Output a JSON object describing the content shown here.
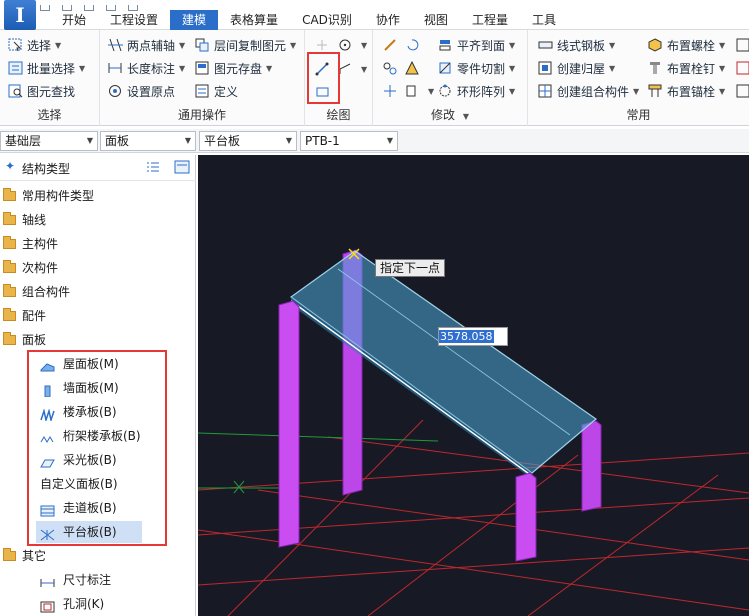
{
  "app": {
    "logo_letter": "I"
  },
  "tabs": [
    "开始",
    "工程设置",
    "建模",
    "表格算量",
    "CAD识别",
    "协作",
    "视图",
    "工程量",
    "工具"
  ],
  "ribbon": {
    "select_group": {
      "title": "选择",
      "items": [
        "选择",
        "批量选择",
        "图元查找"
      ]
    },
    "common_ops_group": {
      "title": "通用操作",
      "items": [
        "两点辅轴",
        "长度标注",
        "设置原点",
        "层间复制图元",
        "图元存盘",
        "定义"
      ]
    },
    "draw_group": {
      "title": "绘图"
    },
    "modify_group": {
      "title": "修改",
      "items": [
        "平齐到面",
        "零件切割",
        "环形阵列"
      ]
    },
    "common_group": {
      "title": "常用",
      "items": [
        "线式钢板",
        "创建归屋",
        "创建组合构件",
        "布置螺栓",
        "布置栓钉",
        "布置锚栓"
      ]
    }
  },
  "selectors": {
    "floor": "基础层",
    "category": "面板",
    "type": "平台板",
    "member": "PTB-1"
  },
  "tree": {
    "header": "结构类型",
    "folders": [
      "常用构件类型",
      "轴线",
      "主构件",
      "次构件",
      "组合构件",
      "配件",
      "面板",
      "其它"
    ],
    "panel_items": [
      "屋面板(M)",
      "墙面板(M)",
      "楼承板(B)",
      "桁架楼承板(B)",
      "采光板(B)",
      "自定义面板(B)",
      "走道板(B)",
      "平台板(B)"
    ],
    "other_items": [
      "尺寸标注",
      "孔洞(K)"
    ]
  },
  "viewport": {
    "tooltip": "指定下一点",
    "length_value": "3578.058"
  },
  "colors": {
    "accent": "#2b6ec9",
    "highlight": "#e53935",
    "column": "#c94df0",
    "slab": "#4aa8d6",
    "grid": "#c0272d",
    "axis_green": "#1f9a3a"
  }
}
